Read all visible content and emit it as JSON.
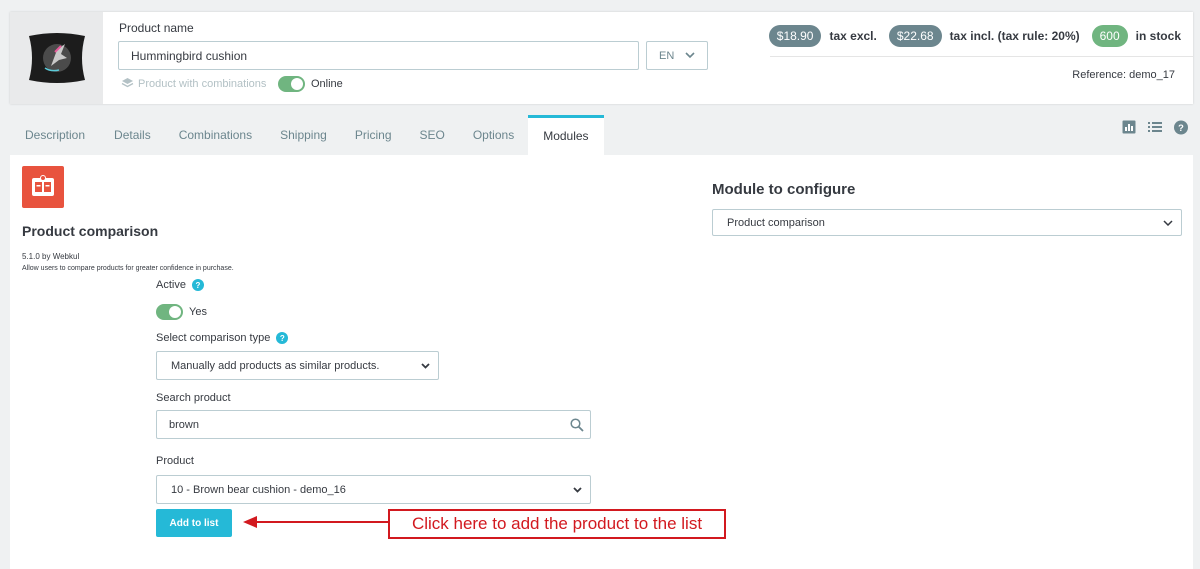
{
  "header": {
    "product_name_label": "Product name",
    "product_name_value": "Hummingbird cushion",
    "language": "EN",
    "combinations_label": "Product with combinations",
    "online_label": "Online",
    "price_excl": "$18.90",
    "tax_excl_label": "tax excl.",
    "price_incl": "$22.68",
    "tax_incl_label": "tax incl. (tax rule: 20%)",
    "stock_count": "600",
    "stock_label": "in stock",
    "reference": "Reference: demo_17"
  },
  "tabs": [
    {
      "label": "Description"
    },
    {
      "label": "Details"
    },
    {
      "label": "Combinations"
    },
    {
      "label": "Shipping"
    },
    {
      "label": "Pricing"
    },
    {
      "label": "SEO"
    },
    {
      "label": "Options"
    },
    {
      "label": "Modules"
    }
  ],
  "active_tab": "Modules",
  "module": {
    "title": "Product comparison",
    "version": "5.1.0 by Webkul",
    "description": "Allow users to compare products for greater confidence in purchase.",
    "active_label": "Active",
    "active_value": "Yes",
    "comparison_type_label": "Select comparison type",
    "comparison_type_value": "Manually add products as similar products.",
    "search_label": "Search product",
    "search_value": "brown",
    "product_label": "Product",
    "product_value": "10 - Brown bear cushion - demo_16",
    "add_button": "Add to list"
  },
  "module_to_configure": {
    "title": "Module to configure",
    "value": "Product comparison"
  },
  "annotation": {
    "text": "Click here to add the product to the list",
    "color": "#d2191f"
  },
  "colors": {
    "accent": "#25b9d7",
    "success": "#70b580",
    "muted": "#6c868e"
  },
  "icons": [
    "product-thumbnail",
    "layers-icon",
    "chart-icon",
    "list-icon",
    "help-icon",
    "search-icon",
    "chevron-down-icon",
    "module-icon"
  ]
}
